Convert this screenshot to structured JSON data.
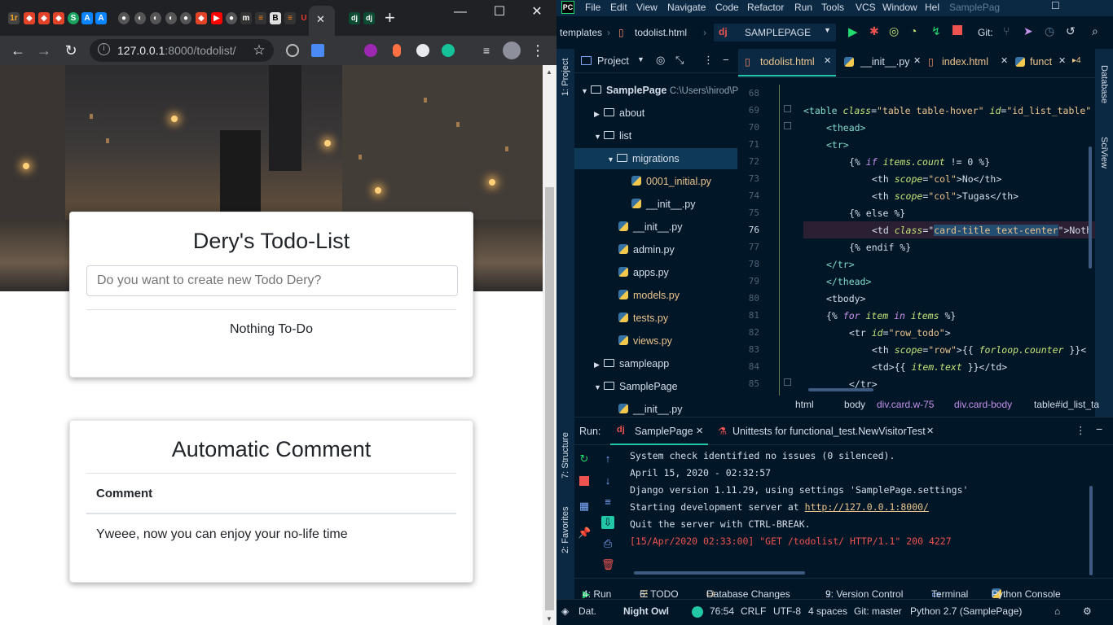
{
  "browser": {
    "tabs": [
      "dj",
      "dj"
    ],
    "url_host": "127.0.0.1",
    "url_rest": ":8000/todolist/",
    "new_tab": "+",
    "minimize": "—",
    "maximize": "☐",
    "close": "✕"
  },
  "page": {
    "todo_title": "Dery's Todo-List",
    "todo_placeholder": "Do you want to create new Todo Dery?",
    "empty_text": "Nothing To-Do",
    "comment_title": "Automatic Comment",
    "comment_header": "Comment",
    "comment_text": "Yweee, now you can enjoy your no-life time"
  },
  "ide": {
    "menu": [
      "File",
      "Edit",
      "View",
      "Navigate",
      "Code",
      "Refactor",
      "Run",
      "Tools",
      "VCS",
      "Window",
      "Hel"
    ],
    "project_name_title": "SamplePag",
    "nav_folder": "templates",
    "nav_file": "todolist.html",
    "run_config": "SAMPLEPAGE",
    "git_label": "Git:",
    "project_label": "Project",
    "left_tools": [
      "1: Project",
      "7: Structure",
      "2: Favorites"
    ],
    "right_tools": [
      "Database",
      "SciView"
    ],
    "tree": [
      {
        "label": "SamplePage",
        "extra": "C:\\Users\\hirod\\P"
      },
      {
        "label": "about"
      },
      {
        "label": "list"
      },
      {
        "label": "migrations"
      },
      {
        "label": "0001_initial.py"
      },
      {
        "label": "__init__.py"
      },
      {
        "label": "__init__.py"
      },
      {
        "label": "admin.py"
      },
      {
        "label": "apps.py"
      },
      {
        "label": "models.py"
      },
      {
        "label": "tests.py"
      },
      {
        "label": "views.py"
      },
      {
        "label": "sampleapp"
      },
      {
        "label": "SamplePage"
      },
      {
        "label": "__init__.py"
      }
    ],
    "editor_tabs": [
      "todolist.html",
      "__init__.py",
      "index.html",
      "funct"
    ],
    "editor_tab_count": "4",
    "line_numbers": [
      "68",
      "69",
      "70",
      "71",
      "72",
      "73",
      "74",
      "75",
      "76",
      "77",
      "78",
      "79",
      "80",
      "81",
      "82",
      "83",
      "84",
      "85"
    ],
    "code": {
      "l69_a": "<table ",
      "l69_b": "class",
      "l69_c": "=",
      "l69_d": "\"table table-hover\"",
      "l69_e": " id",
      "l69_f": "=",
      "l69_g": "\"id_list_table\"",
      "l70": "<thead>",
      "l71": "<tr>",
      "l72_a": "{% ",
      "l72_b": "if ",
      "l72_c": "items.count",
      "l72_d": " != 0 %}",
      "l73_a": "<th ",
      "l73_b": "scope",
      "l73_c": "=",
      "l73_d": "\"col\"",
      "l73_e": ">No</th>",
      "l74_a": "<th ",
      "l74_b": "scope",
      "l74_c": "=",
      "l74_d": "\"col\"",
      "l74_e": ">Tugas</th>",
      "l75": "{% else %}",
      "l76_a": "<td ",
      "l76_b": "class",
      "l76_c": "=\"",
      "l76_d": "card-title text-center",
      "l76_e": "\">Noth",
      "l77": "{% endif %}",
      "l78": "</tr>",
      "l79": "</thead>",
      "l80": "<tbody>",
      "l81_a": "{% ",
      "l81_b": "for ",
      "l81_c": "item ",
      "l81_d": "in ",
      "l81_e": "items",
      "l81_f": " %}",
      "l82_a": "<tr ",
      "l82_b": "id",
      "l82_c": "=",
      "l82_d": "\"row_todo\"",
      "l82_e": ">",
      "l83_a": "<th ",
      "l83_b": "scope",
      "l83_c": "=",
      "l83_d": "\"row\"",
      "l83_e": ">{{ ",
      "l83_f": "forloop.counter",
      "l83_g": " }}<",
      "l84_a": "<td>{{ ",
      "l84_b": "item.text",
      "l84_c": " }}</td>",
      "l85": "</tr>"
    },
    "breadcrumbs": [
      "html",
      "body",
      "div.card.w-75",
      "div.card-body",
      "table#id_list_ta"
    ],
    "run_label": "Run:",
    "run_tabs": [
      "SamplePage",
      "Unittests for functional_test.NewVisitorTest"
    ],
    "console": [
      "System check identified no issues (0 silenced).",
      "April 15, 2020 - 02:32:57",
      "Django version 1.11.29, using settings 'SamplePage.settings'",
      "Starting development server at ",
      "Quit the server with CTRL-BREAK.",
      "[15/Apr/2020 02:33:00] \"GET /todolist/ HTTP/1.1\" 200 4227"
    ],
    "console_link": "http://127.0.0.1:8000/",
    "bottom_tools": [
      "4: Run",
      "6: TODO",
      "Database Changes",
      "9: Version Control",
      "Terminal",
      "Python Console"
    ],
    "status": {
      "left": "Dat.",
      "theme": "Night Owl",
      "position": "76:54",
      "line_sep": "CRLF",
      "encoding": "UTF-8",
      "indent": "4 spaces",
      "git": "Git: master",
      "interpreter": "Python 2.7 (SamplePage)"
    }
  },
  "colors": {
    "ide_bg": "#011627",
    "browser_dark": "#202124",
    "accent_green": "#22da6e",
    "error_red": "#ef5350"
  }
}
